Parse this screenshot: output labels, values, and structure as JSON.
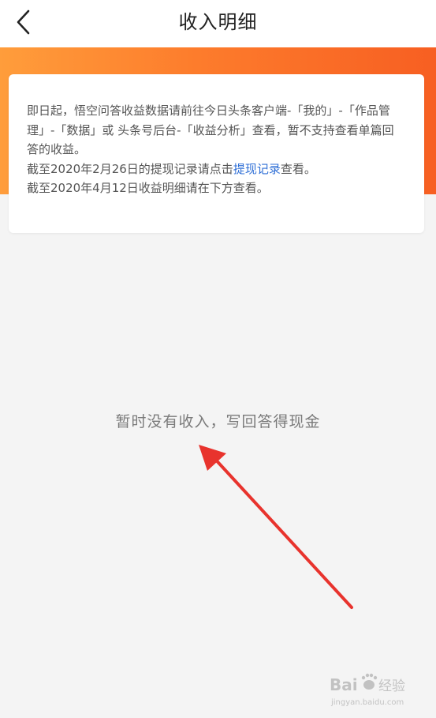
{
  "header": {
    "title": "收入明细",
    "back_icon": "chevron-left-icon"
  },
  "notice": {
    "line1": "即日起，悟空问答收益数据请前往今日头条客户端-「我的」-「作品管理」-「数据」或 头条号后台-「收益分析」查看，暂不支持查看单篇回答的收益。",
    "line2_prefix": "截至2020年2月26日的提现记录请点击",
    "line2_link": "提现记录",
    "line2_suffix": "查看。",
    "line3": "截至2020年4月12日收益明细请在下方查看。"
  },
  "empty_state": {
    "message": "暂时没有收入，写回答得现金"
  },
  "annotation": {
    "arrow_color": "#e8332d"
  },
  "watermark": {
    "brand": "Bai",
    "brand_suffix": "经验",
    "url": "jingyan.baidu.com"
  },
  "colors": {
    "banner_start": "#ff9d3b",
    "banner_end": "#f75f22",
    "link": "#2f6fd6",
    "background": "#f4f4f4"
  }
}
